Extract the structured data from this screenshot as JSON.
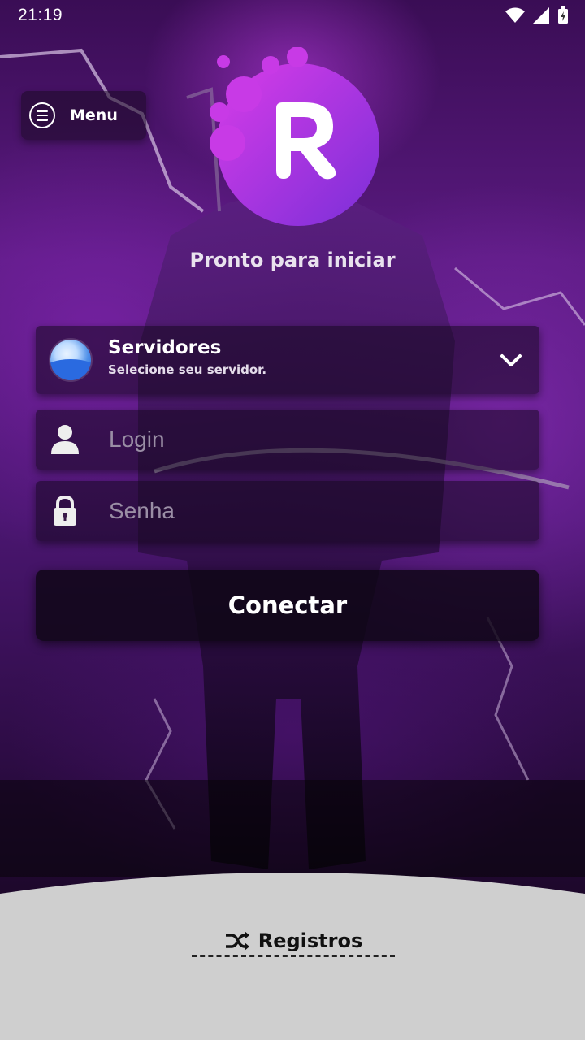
{
  "status_bar": {
    "time": "21:19"
  },
  "menu": {
    "label": "Menu"
  },
  "status_text": "Pronto para iniciar",
  "server": {
    "title": "Servidores",
    "subtitle": "Selecione seu servidor."
  },
  "login": {
    "placeholder": "Login"
  },
  "password": {
    "placeholder": "Senha"
  },
  "connect": {
    "label": "Conectar"
  },
  "logs": {
    "label": "Registros"
  },
  "colors": {
    "accent": "#c43be0",
    "panel": "#cfcfcf"
  }
}
